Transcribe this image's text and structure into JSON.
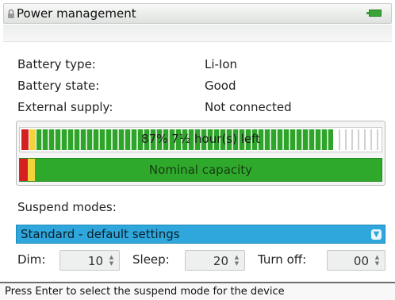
{
  "window": {
    "title": "Power management",
    "title_icon": "lock-icon",
    "status_icon": "battery-icon"
  },
  "info": [
    {
      "label": "Battery type:",
      "value": "Li-Ion"
    },
    {
      "label": "Battery state:",
      "value": "Good"
    },
    {
      "label": "External supply:",
      "value": "Not connected"
    }
  ],
  "charge_bar": {
    "text": "87% 7½ hour(s) left",
    "fill_fraction": 0.87
  },
  "capacity_bar": {
    "text": "Nominal capacity"
  },
  "suspend": {
    "label": "Suspend modes:",
    "selected": "Standard - default settings",
    "dim_label": "Dim:",
    "dim_value": "10",
    "sleep_label": "Sleep:",
    "sleep_value": "20",
    "turnoff_label": "Turn off:",
    "turnoff_value": "00"
  },
  "status": {
    "text": "Press Enter to select the suspend mode for the device"
  },
  "colors": {
    "accent": "#2fa7dc",
    "good": "#2fa92c",
    "warning": "#f2d43a",
    "critical": "#d42020"
  }
}
